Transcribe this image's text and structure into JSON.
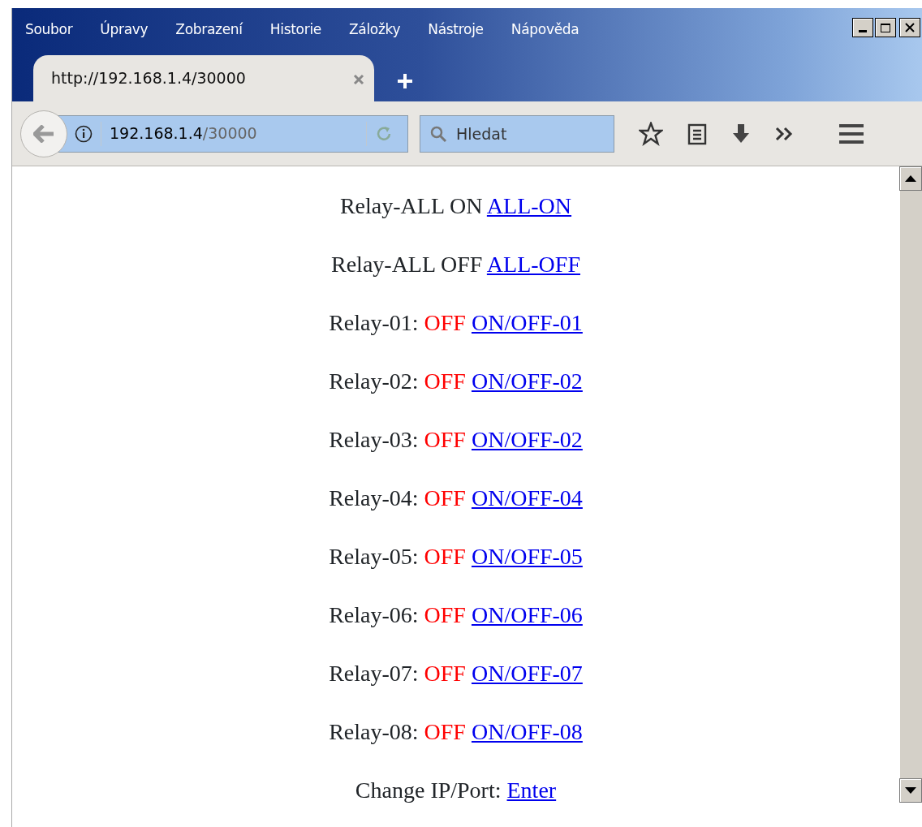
{
  "menu": [
    "Soubor",
    "Úpravy",
    "Zobrazení",
    "Historie",
    "Záložky",
    "Nástroje",
    "Nápověda"
  ],
  "tabs": [
    {
      "title": "http://192.168.1.4/30000",
      "selected": true
    }
  ],
  "address_bar": {
    "host": "192.168.1.4",
    "path": "/30000"
  },
  "search": {
    "placeholder": "Hledat"
  },
  "page": {
    "lines": [
      {
        "label": "Relay-ALL ON",
        "link": "ALL-ON"
      },
      {
        "label": "Relay-ALL OFF",
        "link": "ALL-OFF"
      },
      {
        "label": "Relay-01:",
        "state": "OFF",
        "link": "ON/OFF-01"
      },
      {
        "label": "Relay-02:",
        "state": "OFF",
        "link": "ON/OFF-02"
      },
      {
        "label": "Relay-03:",
        "state": "OFF",
        "link": "ON/OFF-02"
      },
      {
        "label": "Relay-04:",
        "state": "OFF",
        "link": "ON/OFF-04"
      },
      {
        "label": "Relay-05:",
        "state": "OFF",
        "link": "ON/OFF-05"
      },
      {
        "label": "Relay-06:",
        "state": "OFF",
        "link": "ON/OFF-06"
      },
      {
        "label": "Relay-07:",
        "state": "OFF",
        "link": "ON/OFF-07"
      },
      {
        "label": "Relay-08:",
        "state": "OFF",
        "link": "ON/OFF-08"
      },
      {
        "label": "Change IP/Port:",
        "link": "Enter"
      }
    ]
  }
}
